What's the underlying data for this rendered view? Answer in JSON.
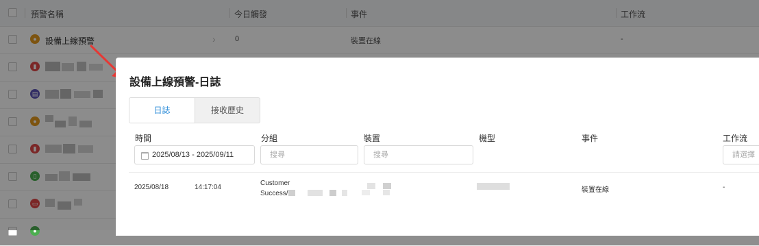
{
  "table": {
    "headers": {
      "name": "預警名稱",
      "triggered_today": "今日觸發",
      "event": "事件",
      "workflow": "工作流"
    },
    "rows": [
      {
        "name": "設備上線預警",
        "triggered_today": "0",
        "event": "裝置在線",
        "workflow": "-"
      }
    ]
  },
  "drawer": {
    "title": "設備上線預警-日誌",
    "tabs": [
      {
        "label": "日誌",
        "active": true
      },
      {
        "label": "接收歷史",
        "active": false
      }
    ],
    "filters": {
      "time": {
        "label": "時間",
        "value": "2025/08/13 - 2025/09/11"
      },
      "group": {
        "label": "分組",
        "placeholder": "搜尋"
      },
      "device": {
        "label": "裝置",
        "placeholder": "搜尋"
      },
      "model": {
        "label": "機型"
      },
      "event": {
        "label": "事件"
      },
      "workflow": {
        "label": "工作流",
        "placeholder": "請選擇"
      }
    },
    "log_rows": [
      {
        "date": "2025/08/18",
        "time": "14:17:04",
        "group_line1": "Customer",
        "group_line2": "Success/",
        "event": "裝置在線",
        "workflow": "-"
      }
    ]
  },
  "colors": {
    "accent": "#2a8bd8",
    "annotation_arrow": "#e53935",
    "icon_orange": "#e39a1e",
    "icon_red": "#e04848",
    "icon_purple": "#5b54b8",
    "icon_green": "#4caf50"
  },
  "icons": {
    "row_icons": [
      "bell-icon",
      "thermometer-icon",
      "device-icon",
      "bell-icon",
      "thermometer-icon",
      "battery-icon",
      "battery-icon",
      "status-icon"
    ],
    "calendar": "calendar-icon"
  }
}
